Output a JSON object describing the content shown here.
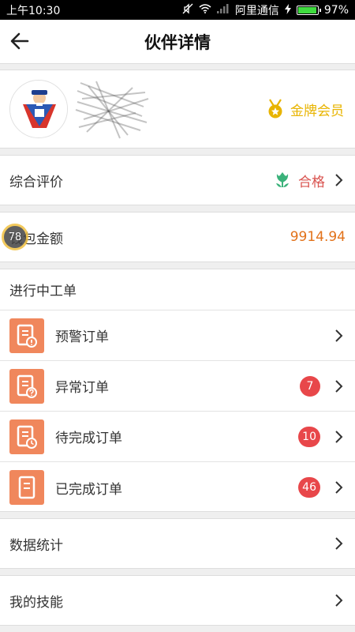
{
  "status_bar": {
    "time": "上午10:30",
    "carrier": "阿里通信",
    "battery": "97%",
    "battery_level": 0.97
  },
  "nav": {
    "back_icon": "arrow-left-icon",
    "title": "伙伴详情"
  },
  "profile": {
    "member_label": "金牌会员",
    "member_icon": "gold-medal-icon"
  },
  "rating": {
    "label": "综合评价",
    "value": "合格",
    "icon": "tulip-icon"
  },
  "wallet": {
    "label": "钱包金额",
    "amount": "9914.94",
    "badge": "78"
  },
  "orders": {
    "title": "进行中工单",
    "items": [
      {
        "label": "预警订单",
        "badge": "",
        "icon": "warning-order-icon"
      },
      {
        "label": "异常订单",
        "badge": "7",
        "icon": "exception-order-icon"
      },
      {
        "label": "待完成订单",
        "badge": "10",
        "icon": "pending-order-icon"
      },
      {
        "label": "已完成订单",
        "badge": "46",
        "icon": "completed-order-icon"
      }
    ]
  },
  "stats": {
    "label": "数据统计"
  },
  "skills": {
    "label": "我的技能"
  },
  "colors": {
    "accent_orange": "#f0875c",
    "badge_red": "#e8474a",
    "gold": "#e8b400",
    "amount_orange": "#e2721a",
    "rating_red": "#d9534f"
  }
}
